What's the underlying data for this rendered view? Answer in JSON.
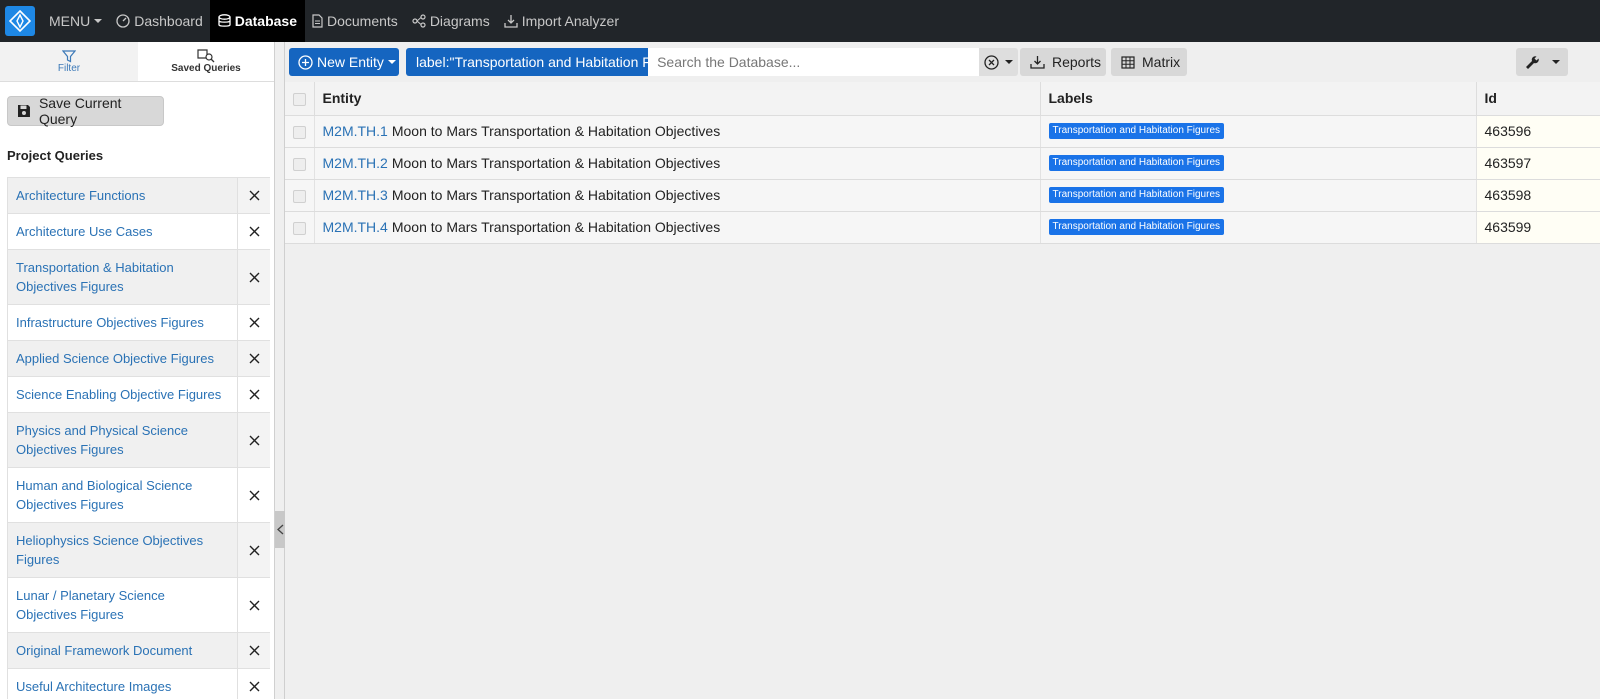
{
  "nav": {
    "menu_label": "MENU",
    "items": [
      {
        "label": "Dashboard",
        "icon": "dashboard-icon"
      },
      {
        "label": "Database",
        "icon": "database-icon",
        "active": true
      },
      {
        "label": "Documents",
        "icon": "document-icon"
      },
      {
        "label": "Diagrams",
        "icon": "diagram-icon"
      },
      {
        "label": "Import Analyzer",
        "icon": "import-icon"
      }
    ]
  },
  "sidebar": {
    "tabs": {
      "filter": "Filter",
      "saved": "Saved Queries"
    },
    "save_button": "Save Current Query",
    "section_title": "Project Queries",
    "queries": [
      "Architecture Functions",
      "Architecture Use Cases",
      "Transportation & Habitation Objectives Figures",
      "Infrastructure Objectives Figures",
      "Applied Science Objective Figures",
      "Science Enabling Objective Figures",
      "Physics and Physical Science Objectives Figures",
      "Human and Biological Science Objectives Figures",
      "Heliophysics Science Objectives Figures",
      "Lunar / Planetary Science Objectives Figures",
      "Original Framework Document",
      "Useful Architecture Images"
    ]
  },
  "toolbar": {
    "new_entity": "New Entity",
    "query_chip": "label:\"Transportation and Habitation Figures\"",
    "search_placeholder": "Search the Database...",
    "reports": "Reports",
    "matrix": "Matrix"
  },
  "table": {
    "headers": {
      "entity": "Entity",
      "labels": "Labels",
      "id": "Id"
    },
    "rows": [
      {
        "code": "M2M.TH.1",
        "name": "Moon to Mars Transportation & Habitation Objectives",
        "label": "Transportation and Habitation Figures",
        "id": "463596"
      },
      {
        "code": "M2M.TH.2",
        "name": "Moon to Mars Transportation & Habitation Objectives",
        "label": "Transportation and Habitation Figures",
        "id": "463597"
      },
      {
        "code": "M2M.TH.3",
        "name": "Moon to Mars Transportation & Habitation Objectives",
        "label": "Transportation and Habitation Figures",
        "id": "463598"
      },
      {
        "code": "M2M.TH.4",
        "name": "Moon to Mars Transportation & Habitation Objectives",
        "label": "Transportation and Habitation Figures",
        "id": "463599"
      }
    ]
  },
  "colors": {
    "nav_bg": "#212529",
    "primary": "#1565c0",
    "label_badge": "#1a73e8",
    "link": "#2a72b5"
  }
}
